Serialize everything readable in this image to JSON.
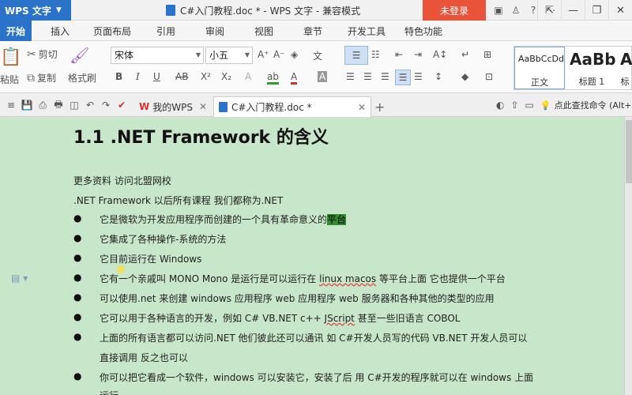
{
  "titlebar": {
    "app_name": "WPS 文字",
    "doc_title": "C#入门教程.doc * - WPS 文字 - 兼容模式",
    "login_label": "未登录",
    "icons": [
      "skin-icon",
      "shirt-icon",
      "help-icon",
      "collapse-icon"
    ],
    "window_buttons": [
      "minimize-icon",
      "restore-icon",
      "close-icon"
    ]
  },
  "menu": {
    "tabs": [
      "开始",
      "插入",
      "页面布局",
      "引用",
      "审阅",
      "视图",
      "章节",
      "开发工具",
      "特色功能"
    ]
  },
  "ribbon": {
    "cut_label": "剪切",
    "paste_label": "粘贴",
    "copy_label": "复制",
    "format_painter_label": "格式刷",
    "font_name": "宋体",
    "font_size": "小五",
    "styles": [
      {
        "preview": "AaBbCcDd",
        "name": "正文"
      },
      {
        "preview": "AaBb",
        "name": "标题 1"
      },
      {
        "preview": "Aa",
        "name": "标"
      }
    ]
  },
  "tabbar": {
    "tabs": [
      {
        "label": "我的WPS"
      },
      {
        "label": "C#入门教程.doc *"
      }
    ],
    "search_command": "点此查找命令 (Alt+"
  },
  "document": {
    "heading": "1.1 .NET Framework 的含义",
    "line1": "更多资料  访问北盟网校",
    "line2": ".NET Framework 以后所有课程  我们都称为.NET",
    "bullet_char": "●",
    "bullets": [
      {
        "pre": "它是微软为开发应用程序而创建的一个具有革命意义的",
        "hl": "平台"
      },
      {
        "text": "它集成了各种操作-系统的方法"
      },
      {
        "text": "它目前运行在 Windows"
      },
      {
        "pre": "它有一个亲戚叫 MONO Mono 是运行是可以运行在 ",
        "sq": "linux macos",
        "post": " 等平台上面  它也提供一个平台"
      },
      {
        "text": "可以使用.net 来创建 windows 应用程序  web 应用程序  web 服务器和各种其他的类型的应用"
      },
      {
        "pre": "它可以用于各种语言的开发，例如 C# VB.NET c++ ",
        "sq": "JScript",
        "post": "  甚至一些旧语言  COBOL"
      },
      {
        "text": "上面的所有语言都可以访问.NET  他们彼此还可以通讯  如 C#开发人员写的代码  VB.NET 开发人员可以",
        "cont": "直接调用  反之也可以"
      },
      {
        "text": "你可以把它看成一个软件，windows 可以安装它，安装了后  用 C#开发的程序就可以在 windows 上面",
        "cont": "运行"
      }
    ]
  }
}
